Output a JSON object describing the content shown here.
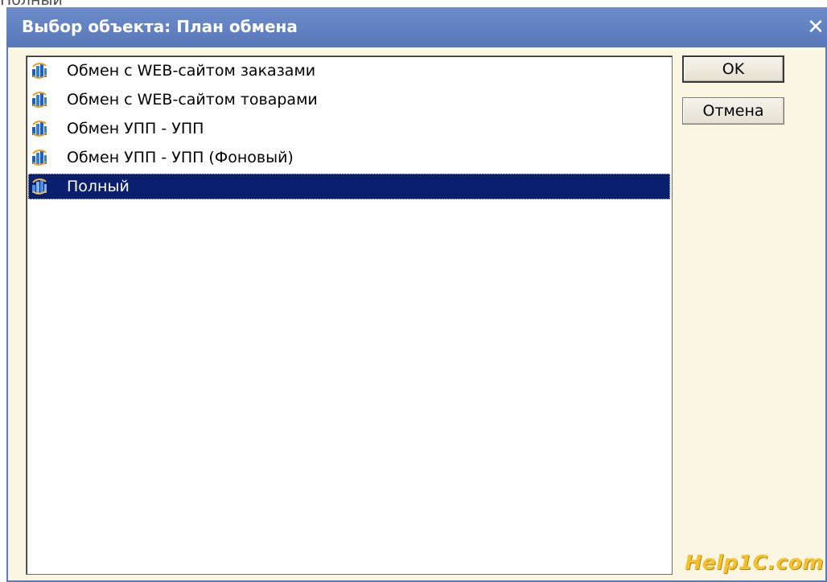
{
  "background_caption": "Полный",
  "dialog": {
    "title": "Выбор объекта: План обмена",
    "close_symbol": "✕"
  },
  "list": {
    "items": [
      {
        "label": "Обмен с WEB-сайтом заказами",
        "icon": "exchange-plan-icon",
        "selected": false
      },
      {
        "label": "Обмен с WEB-сайтом товарами",
        "icon": "exchange-plan-icon",
        "selected": false
      },
      {
        "label": "Обмен УПП - УПП",
        "icon": "exchange-plan-icon",
        "selected": false
      },
      {
        "label": "Обмен УПП - УПП (Фоновый)",
        "icon": "exchange-plan-icon",
        "selected": false
      },
      {
        "label": "Полный",
        "icon": "exchange-plan-icon",
        "selected": true
      }
    ]
  },
  "buttons": {
    "ok_label": "OK",
    "cancel_label": "Отмена"
  },
  "watermark": "Help1C.com",
  "colors": {
    "titlebar": "#5a7bbd",
    "client_background": "#fbf6e1",
    "selection": "#0a1f6e"
  }
}
